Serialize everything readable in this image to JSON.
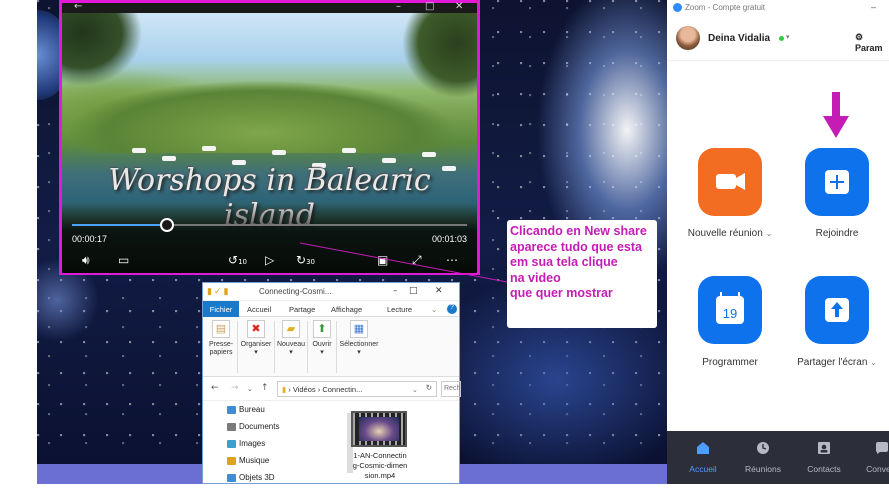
{
  "video_player": {
    "title_overlay": "Worshops in Balearic island",
    "time_current": "00:00:17",
    "time_total": "00:01:03",
    "progress_fraction": 0.24,
    "skip_back_label": "10",
    "skip_forward_label": "30",
    "icons": [
      "back-arrow-icon",
      "volume-icon",
      "subtitles-icon",
      "skip-back-icon",
      "play-icon",
      "skip-forward-icon",
      "miniplayer-icon",
      "fullscreen-icon",
      "more-icon"
    ]
  },
  "explorer": {
    "title": "Connecting-Cosmi...",
    "tabs": [
      "Fichier",
      "Accueil",
      "Partage",
      "Affichage",
      "Lecture"
    ],
    "ribbon": [
      {
        "label": "Presse-papiers",
        "line1": "Presse-",
        "line2": "papiers"
      },
      {
        "label": "Organiser",
        "line1": "Organiser",
        "line2": ""
      },
      {
        "label": "Nouveau",
        "line1": "Nouveau",
        "line2": ""
      },
      {
        "label": "Ouvrir",
        "line1": "Ouvrir",
        "line2": ""
      },
      {
        "label": "Sélectionner",
        "line1": "Sélectionner",
        "line2": ""
      }
    ],
    "address": {
      "part1": "Vidéos",
      "sep": "›",
      "part2": "Connectin..."
    },
    "search_placeholder": "Rech",
    "tree": [
      {
        "label": "Bureau",
        "color": "#3b8fd8"
      },
      {
        "label": "Documents",
        "color": "#7a7a7a"
      },
      {
        "label": "Images",
        "color": "#3ba0d0"
      },
      {
        "label": "Musique",
        "color": "#e0a020"
      },
      {
        "label": "Objets 3D",
        "color": "#3b8fd8"
      }
    ],
    "file": {
      "name_lines": [
        "1-AN-Connectin",
        "g-Cosmic-dimen",
        "sion.mp4"
      ]
    }
  },
  "annotation": {
    "lines": [
      "Clicando en New share",
      "aparece tudo que esta",
      "em sua tela clique",
      "na video",
      "que quer mostrar"
    ],
    "color": "#c41cb5"
  },
  "zoom": {
    "window_title": "Zoom - Compte gratuit",
    "user_name": "Deina Vidalia",
    "settings_label": "Param",
    "buttons": [
      {
        "label": "Nouvelle réunion",
        "chevron": "⌄",
        "icon": "video-camera-icon",
        "color": "#f26d21"
      },
      {
        "label": "Rejoindre",
        "chevron": "",
        "icon": "plus-icon",
        "color": "#0e72ed"
      },
      {
        "label": "Programmer",
        "chevron": "",
        "icon": "calendar-icon",
        "calendar_day": "19",
        "color": "#0e72ed"
      },
      {
        "label": "Partager l'écran",
        "chevron": "⌄",
        "icon": "share-screen-icon",
        "color": "#0e72ed"
      }
    ],
    "nav": [
      {
        "label": "Accueil",
        "icon": "home-icon",
        "active": true
      },
      {
        "label": "Réunions",
        "icon": "clock-icon",
        "active": false
      },
      {
        "label": "Contacts",
        "icon": "contacts-icon",
        "active": false
      },
      {
        "label": "Convers",
        "icon": "chat-icon",
        "active": false
      }
    ],
    "accent": "#0e72ed",
    "arrow_color": "#c41cb5"
  }
}
